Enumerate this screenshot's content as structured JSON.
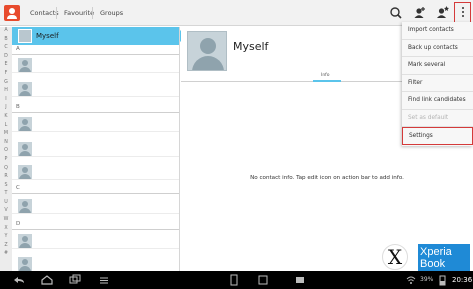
{
  "actionbar": {
    "tabs": [
      "Contacts",
      "Favourite",
      "Groups"
    ],
    "icons": [
      "search-icon",
      "add-contact-icon",
      "add-favourite-icon",
      "overflow-menu-icon"
    ]
  },
  "list": {
    "alphabet": [
      "A",
      "B",
      "C",
      "D",
      "E",
      "F",
      "G",
      "H",
      "I",
      "J",
      "K",
      "L",
      "M",
      "N",
      "O",
      "P",
      "Q",
      "R",
      "S",
      "T",
      "U",
      "V",
      "W",
      "X",
      "Y",
      "Z",
      "#"
    ],
    "me_label": "Myself",
    "sections": [
      "A",
      "B",
      "C",
      "D"
    ]
  },
  "detail": {
    "name": "Myself",
    "tab": "Info",
    "empty_message": "No contact info. Tap edit icon on action bar to add info."
  },
  "menu": {
    "items": [
      "Import contacts",
      "Back up contacts",
      "Mark several",
      "Filter",
      "Find link candidates",
      "Set as default",
      "Settings"
    ]
  },
  "watermark": {
    "letter": "X",
    "logo_line1": "Xperia",
    "logo_line2": "Book"
  },
  "sysbar": {
    "battery": "39%",
    "clock": "20:36"
  },
  "colors": {
    "accent": "#5bc4eb",
    "highlight_border": "#d43a3a",
    "app_icon": "#e84b2d"
  }
}
